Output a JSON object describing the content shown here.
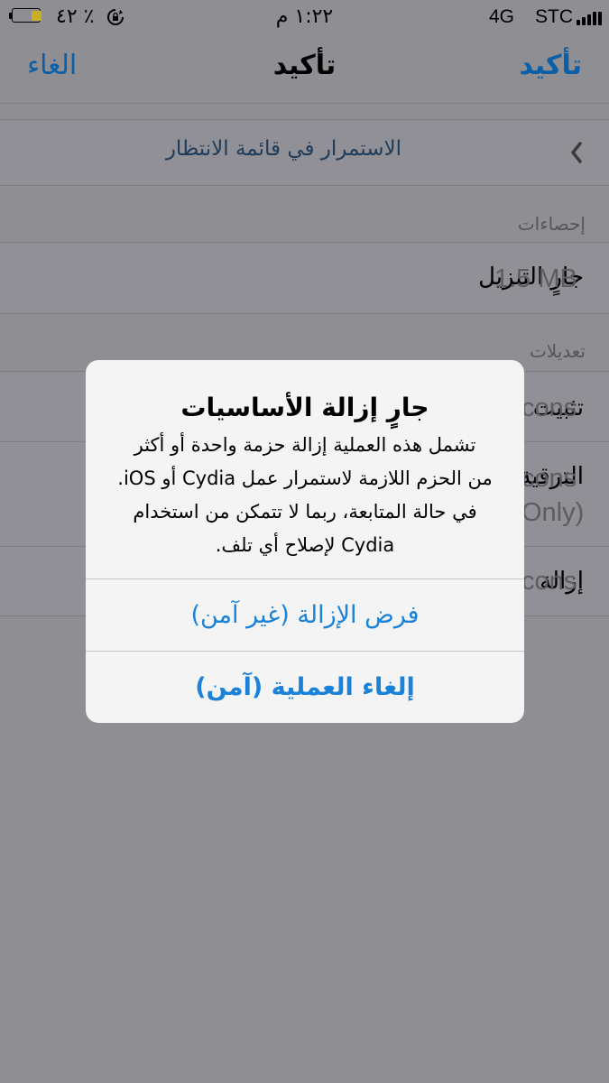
{
  "status_bar": {
    "carrier": "STC",
    "network": "4G",
    "time": "١:٢٢ م",
    "battery_percent": "٪ ٤٢",
    "battery_level": 0.42,
    "battery_color": "#c9b022"
  },
  "nav": {
    "title": "تأكيد",
    "confirm_label": "تأكيد",
    "cancel_label": "الغاء"
  },
  "queue_row": {
    "label": "الاستمرار في قائمة الانتظار",
    "icon": "chevron-left-icon"
  },
  "stats": {
    "header": "إحصاءات",
    "download_label": "جارٍ التنزيل",
    "download_value": "1.5 MB"
  },
  "changes": {
    "header": "تعديلات",
    "rows": [
      {
        "label": "تثبيت",
        "value": "cons"
      },
      {
        "label": "الترقية",
        "value": "cons",
        "value2": "Only)"
      },
      {
        "label": "إزالة",
        "value": "cons"
      }
    ]
  },
  "alert": {
    "title": "جارٍ إزالة الأساسيات",
    "message_lines": [
      "تشمل هذه العملية إزالة حزمة واحدة أو أكثر",
      "من الحزم اللازمة لاستمرار عمل Cydia أو iOS.",
      "في حالة المتابعة، ربما لا تتمكن من استخدام",
      "Cydia لإصلاح أي تلف."
    ],
    "force_button": "فرض الإزالة (غير آمن)",
    "cancel_button": "إلغاء العملية (آمن)"
  },
  "colors": {
    "accent": "#0b5fa8",
    "alert_button": "#1a82d9",
    "dim_background": "#8e8e93"
  }
}
